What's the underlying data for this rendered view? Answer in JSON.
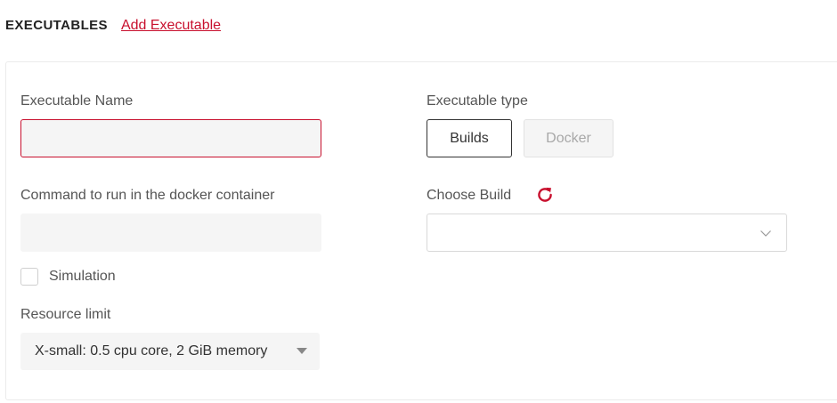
{
  "header": {
    "title": "EXECUTABLES",
    "add_link": "Add Executable"
  },
  "form": {
    "name_label": "Executable Name",
    "name_value": "",
    "command_label": "Command to run in the docker container",
    "command_value": "",
    "simulation_label": "Simulation",
    "simulation_checked": false,
    "resource_label": "Resource limit",
    "resource_value": "X-small: 0.5 cpu core, 2 GiB memory",
    "type_label": "Executable type",
    "type_options": [
      "Builds",
      "Docker"
    ],
    "type_selected": "Builds",
    "build_label": "Choose Build",
    "build_value": ""
  },
  "colors": {
    "accent": "#c8102e",
    "input_bg": "#f5f5f5",
    "border": "#ebebeb"
  },
  "icons": {
    "refresh": "refresh-icon",
    "build_dropdown": "chevron-down-icon",
    "resource_dropdown": "caret-down-icon"
  }
}
